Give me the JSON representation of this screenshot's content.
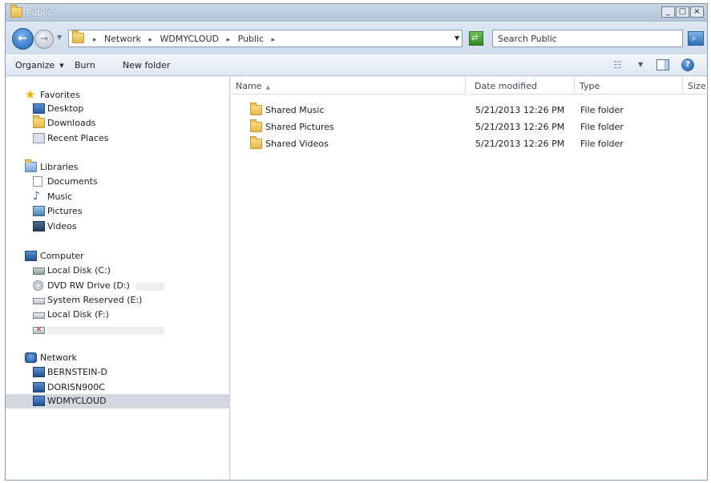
{
  "window": {
    "title": "Public",
    "controls": {
      "minimize": "_",
      "maximize": "□",
      "close": "×"
    }
  },
  "address_bar": {
    "crumbs": [
      "Network",
      "WDMYCLOUD",
      "Public"
    ],
    "separator": "▸"
  },
  "search": {
    "placeholder": "Search Public"
  },
  "toolbar": {
    "organize": "Organize",
    "burn": "Burn",
    "new_folder": "New folder"
  },
  "nav": {
    "favorites": {
      "label": "Favorites",
      "items": [
        "Desktop",
        "Downloads",
        "Recent Places"
      ]
    },
    "libraries": {
      "label": "Libraries",
      "items": [
        "Documents",
        "Music",
        "Pictures",
        "Videos"
      ]
    },
    "computer": {
      "label": "Computer",
      "items": [
        "Local Disk (C:)",
        "DVD RW Drive (D:)",
        "System Reserved (E:)",
        "Local Disk (F:)"
      ]
    },
    "network": {
      "label": "Network",
      "items": [
        "BERNSTEIN-D",
        "DORISN900C",
        "WDMYCLOUD"
      ],
      "selected": "WDMYCLOUD"
    }
  },
  "columns": {
    "name": "Name",
    "date": "Date modified",
    "type": "Type",
    "size": "Size"
  },
  "files": [
    {
      "name": "Shared Music",
      "date": "5/21/2013 12:26 PM",
      "type": "File folder"
    },
    {
      "name": "Shared Pictures",
      "date": "5/21/2013 12:26 PM",
      "type": "File folder"
    },
    {
      "name": "Shared Videos",
      "date": "5/21/2013 12:26 PM",
      "type": "File folder"
    }
  ],
  "colors": {
    "selection": "#d3d8de",
    "folder": "#e6b84a",
    "accent": "#1f5fb0"
  }
}
